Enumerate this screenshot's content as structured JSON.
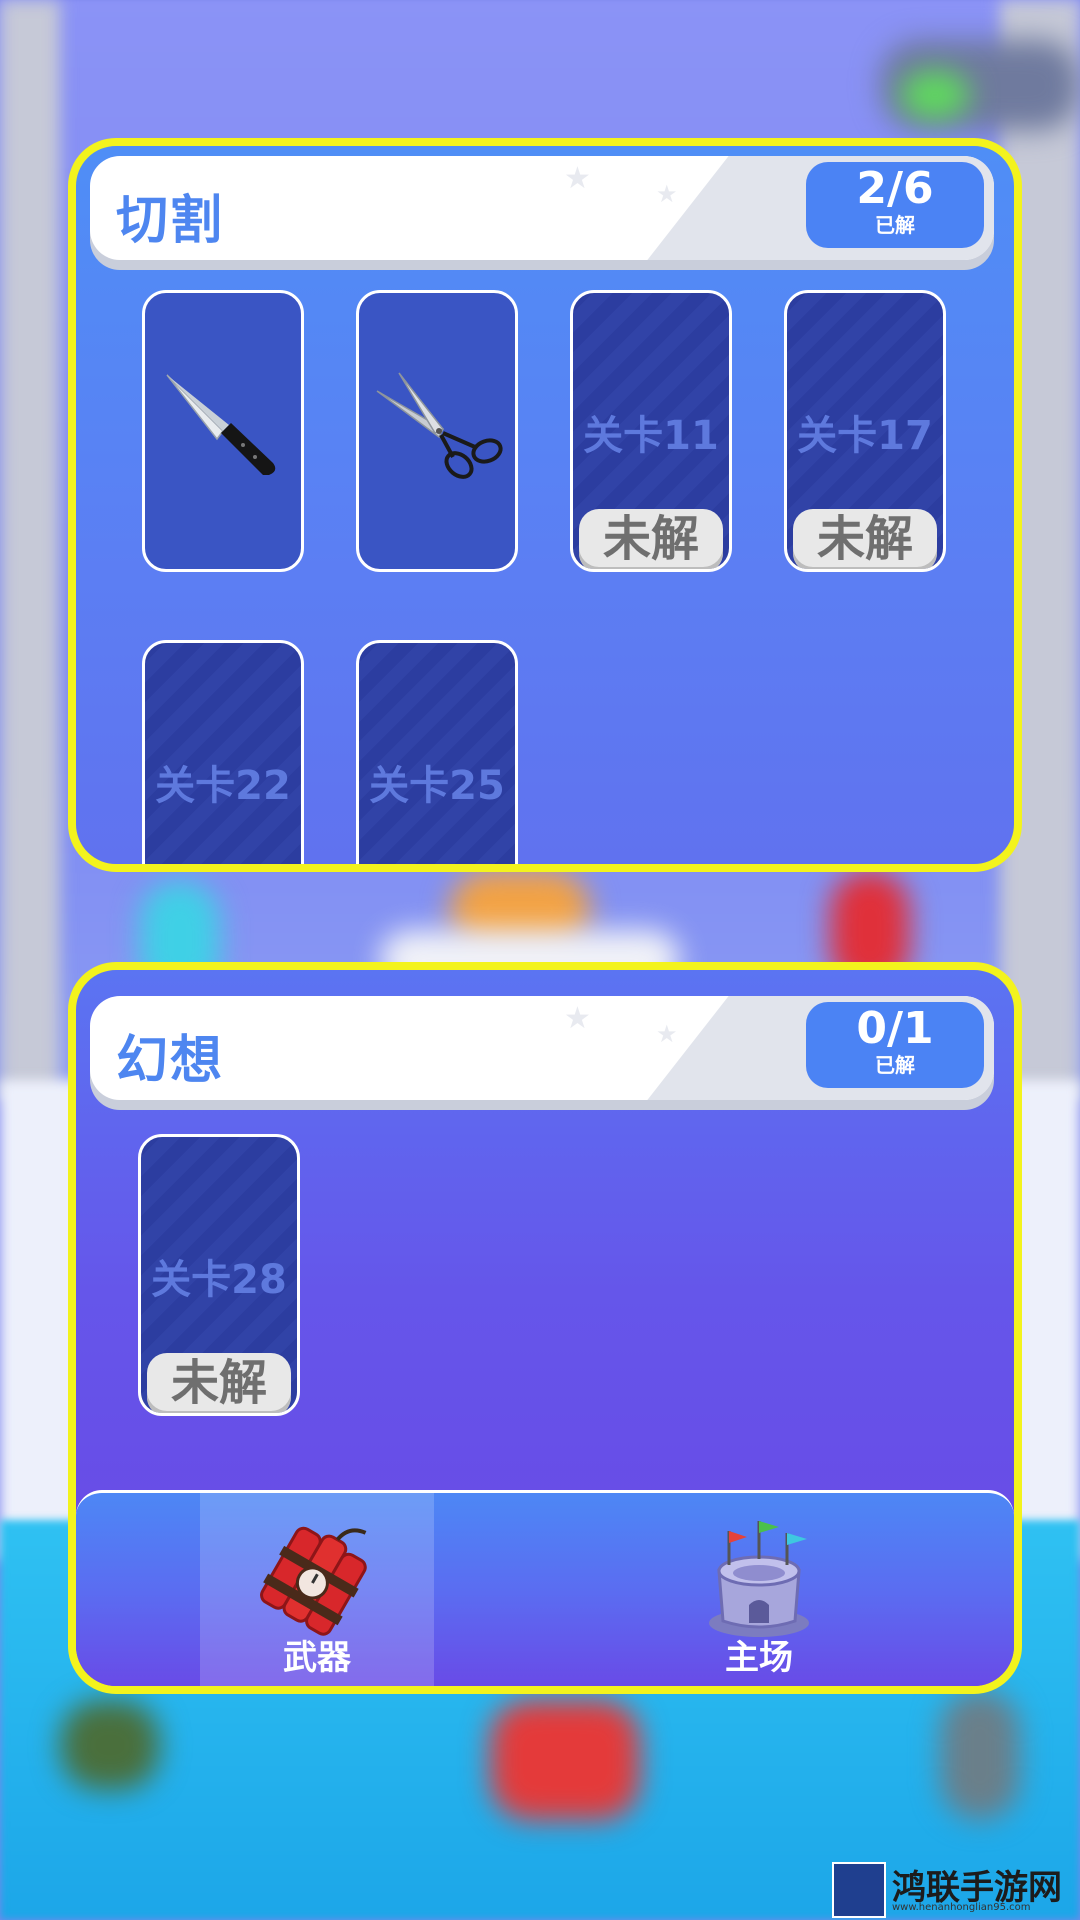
{
  "sections": [
    {
      "title": "切割",
      "progress": "2/6",
      "progress_label": "已解",
      "items": [
        {
          "type": "unlocked",
          "icon": "knife-icon"
        },
        {
          "type": "unlocked",
          "icon": "scissors-icon"
        },
        {
          "type": "locked",
          "level": "关卡11",
          "status": "未解"
        },
        {
          "type": "locked",
          "level": "关卡17",
          "status": "未解"
        },
        {
          "type": "locked",
          "level": "关卡22"
        },
        {
          "type": "locked",
          "level": "关卡25"
        }
      ]
    },
    {
      "title": "幻想",
      "progress": "0/1",
      "progress_label": "已解",
      "items": [
        {
          "type": "locked",
          "level": "关卡28",
          "status": "未解"
        }
      ]
    }
  ],
  "nav": {
    "weapons": {
      "label": "武器",
      "icon": "dynamite-icon",
      "active": true
    },
    "arena": {
      "label": "主场",
      "icon": "castle-icon",
      "active": false
    }
  },
  "watermark": {
    "name": "鸿联手游网",
    "url": "www.henanhonglian95.com"
  },
  "colors": {
    "panel_border": "#f3f31d",
    "title_blue": "#4e86f0",
    "badge_blue": "#4b83f4"
  }
}
